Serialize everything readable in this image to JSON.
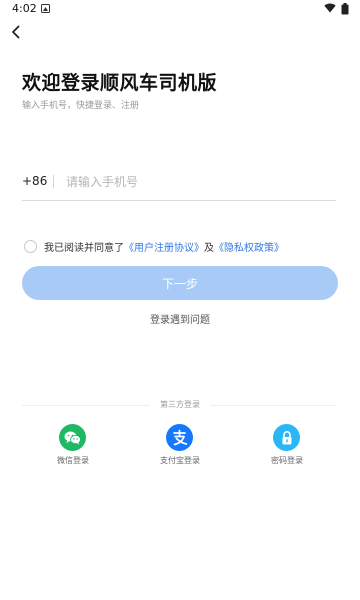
{
  "status_bar": {
    "time": "4:02"
  },
  "header": {
    "title": "欢迎登录顺风车司机版",
    "subtitle": "输入手机号，快捷登录、注册"
  },
  "phone": {
    "country_code": "+86",
    "placeholder": "请输入手机号",
    "value": ""
  },
  "agreement": {
    "prefix": "我已阅读并同意了",
    "user_agreement": "《用户注册协议》",
    "and": "及",
    "privacy_policy": "《隐私权政策》",
    "checked": false
  },
  "actions": {
    "next_label": "下一步",
    "help_label": "登录遇到问题"
  },
  "third_party": {
    "title": "第三方登录",
    "options": [
      {
        "label": "微信登录",
        "icon": "wechat-icon",
        "color": "#1fb864"
      },
      {
        "label": "支付宝登录",
        "icon": "alipay-icon",
        "color": "#1677ff"
      },
      {
        "label": "密码登录",
        "icon": "lock-icon",
        "color": "#29b7f5"
      }
    ]
  },
  "colors": {
    "accent": "#2f7be8",
    "button_disabled": "#a7cbf6"
  }
}
